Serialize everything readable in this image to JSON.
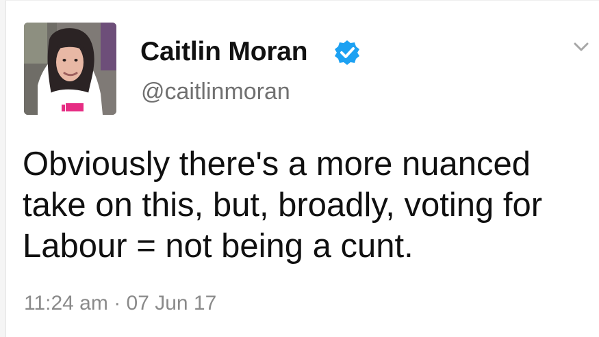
{
  "tweet": {
    "author": {
      "display_name": "Caitlin Moran",
      "handle": "@caitlinmoran",
      "verified_icon": "verified-badge-icon"
    },
    "text_lines": [
      "Obviously there's a more nuanced",
      "take on this, but, broadly, voting for",
      "Labour = not being a cunt."
    ],
    "timestamp": "11:24 am · 07 Jun 17",
    "menu_icon": "chevron-down-icon",
    "colors": {
      "verified": "#1da1f2",
      "text": "#101010",
      "secondary": "#707070"
    }
  }
}
